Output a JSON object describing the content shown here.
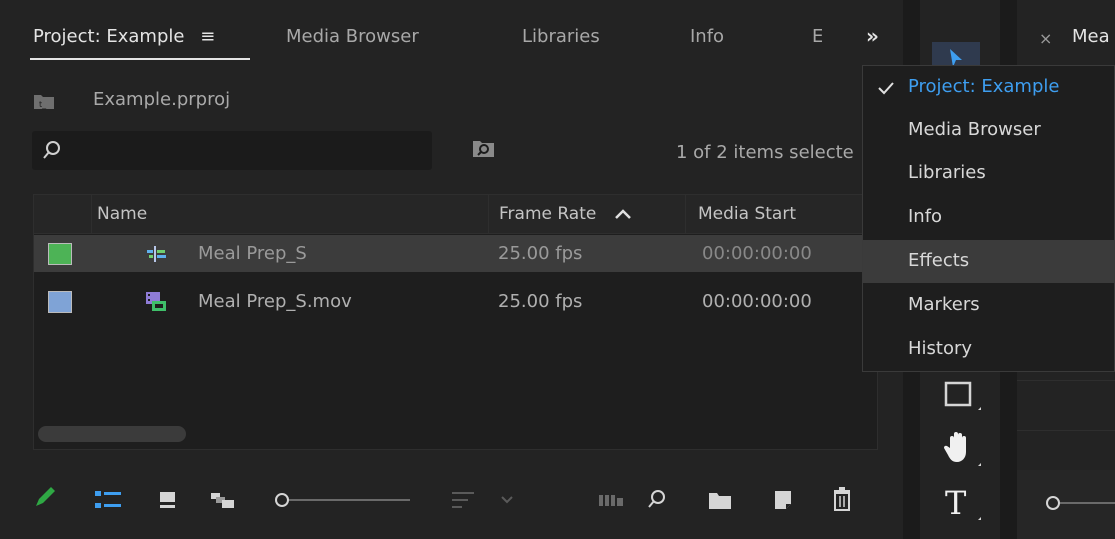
{
  "tabs": [
    {
      "label": "Project: Example",
      "menu_icon": "≡",
      "active": true
    },
    {
      "label": "Media Browser"
    },
    {
      "label": "Libraries"
    },
    {
      "label": "Info"
    },
    {
      "label": "E"
    }
  ],
  "overflow_icon": "»",
  "project_file": "Example.prproj",
  "items_status": "1 of 2 items selecte",
  "table": {
    "headers": {
      "name": "Name",
      "frame_rate": "Frame Rate",
      "media_start": "Media Start"
    },
    "rows": [
      {
        "color": "#4db356",
        "name": "Meal Prep_S",
        "frame_rate": "25.00 fps",
        "media_start": "00:00:00:00",
        "icon": "sequence-icon",
        "selected": true
      },
      {
        "color": "#7fa3d6",
        "name": "Meal Prep_S.mov",
        "frame_rate": "25.00 fps",
        "media_start": "00:00:00:00",
        "icon": "video-clip-icon"
      }
    ]
  },
  "menu": {
    "items": [
      {
        "label": "Project: Example",
        "checked": true
      },
      {
        "label": "Media Browser"
      },
      {
        "label": "Libraries"
      },
      {
        "label": "Info"
      },
      {
        "label": "Effects",
        "highlighted": true
      },
      {
        "label": "Markers"
      },
      {
        "label": "History"
      }
    ]
  },
  "right_panel": {
    "close_icon": "×",
    "title": "Mea"
  },
  "colors": {
    "accent": "#3e9ef0",
    "pencil": "#2fa844",
    "list_view": "#3e9ef0"
  }
}
